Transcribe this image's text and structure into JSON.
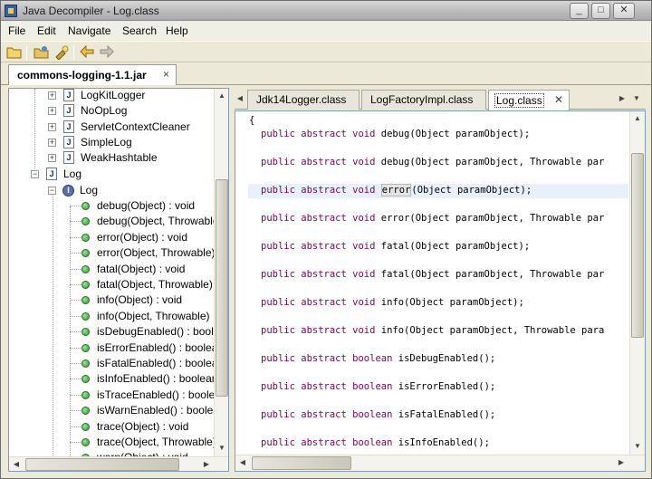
{
  "window": {
    "title": "Java Decompiler - Log.class"
  },
  "menu": [
    "File",
    "Edit",
    "Navigate",
    "Search",
    "Help"
  ],
  "jar_tab": {
    "label": "commons-logging-1.1.jar",
    "close": "×"
  },
  "tree": {
    "packages": [
      "LogKitLogger",
      "NoOpLog",
      "ServletContextCleaner",
      "SimpleLog",
      "WeakHashtable"
    ],
    "open_file": "Log",
    "interface": "Log",
    "methods": [
      "debug(Object) : void",
      "debug(Object, Throwable",
      "error(Object) : void",
      "error(Object, Throwable)",
      "fatal(Object) : void",
      "fatal(Object, Throwable)",
      "info(Object) : void",
      "info(Object, Throwable) :",
      "isDebugEnabled() : boole",
      "isErrorEnabled() : boolean",
      "isFatalEnabled() : boolean",
      "isInfoEnabled() : boolean",
      "isTraceEnabled() : boolea",
      "isWarnEnabled() : boolea",
      "trace(Object) : void",
      "trace(Object, Throwable)",
      "warn(Object) : void"
    ]
  },
  "editor_tabs": [
    {
      "label": "Jdk14Logger.class"
    },
    {
      "label": "LogFactoryImpl.class"
    },
    {
      "label": "Log.class",
      "active": true
    }
  ],
  "code": {
    "open_brace": "{",
    "lines": [
      {
        "mods": "public abstract",
        "type": "void",
        "rest": " debug(Object paramObject);"
      },
      {
        "mods": "public abstract",
        "type": "void",
        "rest": " debug(Object paramObject, Throwable par"
      },
      {
        "mods": "public abstract",
        "type": "void",
        "pre": " ",
        "sel": "error",
        "rest": "(Object paramObject);",
        "highlight": true
      },
      {
        "mods": "public abstract",
        "type": "void",
        "rest": " error(Object paramObject, Throwable par"
      },
      {
        "mods": "public abstract",
        "type": "void",
        "rest": " fatal(Object paramObject);"
      },
      {
        "mods": "public abstract",
        "type": "void",
        "rest": " fatal(Object paramObject, Throwable par"
      },
      {
        "mods": "public abstract",
        "type": "void",
        "rest": " info(Object paramObject);"
      },
      {
        "mods": "public abstract",
        "type": "void",
        "rest": " info(Object paramObject, Throwable para"
      },
      {
        "mods": "public abstract",
        "type": "boolean",
        "rest": " isDebugEnabled();"
      },
      {
        "mods": "public abstract",
        "type": "boolean",
        "rest": " isErrorEnabled();"
      },
      {
        "mods": "public abstract",
        "type": "boolean",
        "rest": " isFatalEnabled();"
      },
      {
        "mods": "public abstract",
        "type": "boolean",
        "rest": " isInfoEnabled();"
      }
    ]
  },
  "colors": {
    "keyword": "#7f0055",
    "line_highlight": "#e8f0fb",
    "tree_border": "#7f9db9"
  }
}
